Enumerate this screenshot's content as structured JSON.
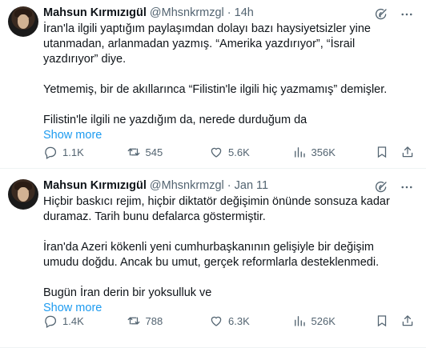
{
  "tweets": [
    {
      "author_name": "Mahsun Kırmızıgül",
      "handle": "@Mhsnkrmzgl",
      "separator": "·",
      "time": "14h",
      "paragraphs": [
        "İran'la ilgili yaptığım paylaşımdan dolayı bazı haysiyetsizler yine utanmadan, arlanmadan yazmış. “Amerika yazdırıyor”, “İsrail yazdırıyor” diye.",
        "Yetmemiş, bir de akıllarınca “Filistin'le ilgili hiç yazmamış” demişler.",
        "Filistin'le ilgili ne yazdığım da, nerede durduğum da"
      ],
      "show_more": "Show more",
      "stats": {
        "replies": "1.1K",
        "reposts": "545",
        "likes": "5.6K",
        "views": "356K"
      }
    },
    {
      "author_name": "Mahsun Kırmızıgül",
      "handle": "@Mhsnkrmzgl",
      "separator": "·",
      "time": "Jan 11",
      "paragraphs": [
        "Hiçbir baskıcı rejim, hiçbir diktatör değişimin önünde sonsuza kadar duramaz. Tarih bunu defalarca göstermiştir.",
        "İran'da Azeri kökenli yeni cumhurbaşkanının gelişiyle bir değişim umudu doğdu. Ancak bu umut, gerçek reformlarla desteklenmedi.",
        "Bugün İran derin bir yoksulluk ve"
      ],
      "show_more": "Show more",
      "stats": {
        "replies": "1.4K",
        "reposts": "788",
        "likes": "6.3K",
        "views": "526K"
      }
    }
  ],
  "icons": {
    "grok": "grok-icon",
    "more": "more-icon",
    "reply": "reply-icon",
    "repost": "repost-icon",
    "like": "heart-icon",
    "views": "views-icon",
    "bookmark": "bookmark-icon",
    "share": "share-icon"
  },
  "colors": {
    "text": "#0f1419",
    "secondary": "#536471",
    "link": "#1d9bf0",
    "divider": "#eff3f4"
  }
}
